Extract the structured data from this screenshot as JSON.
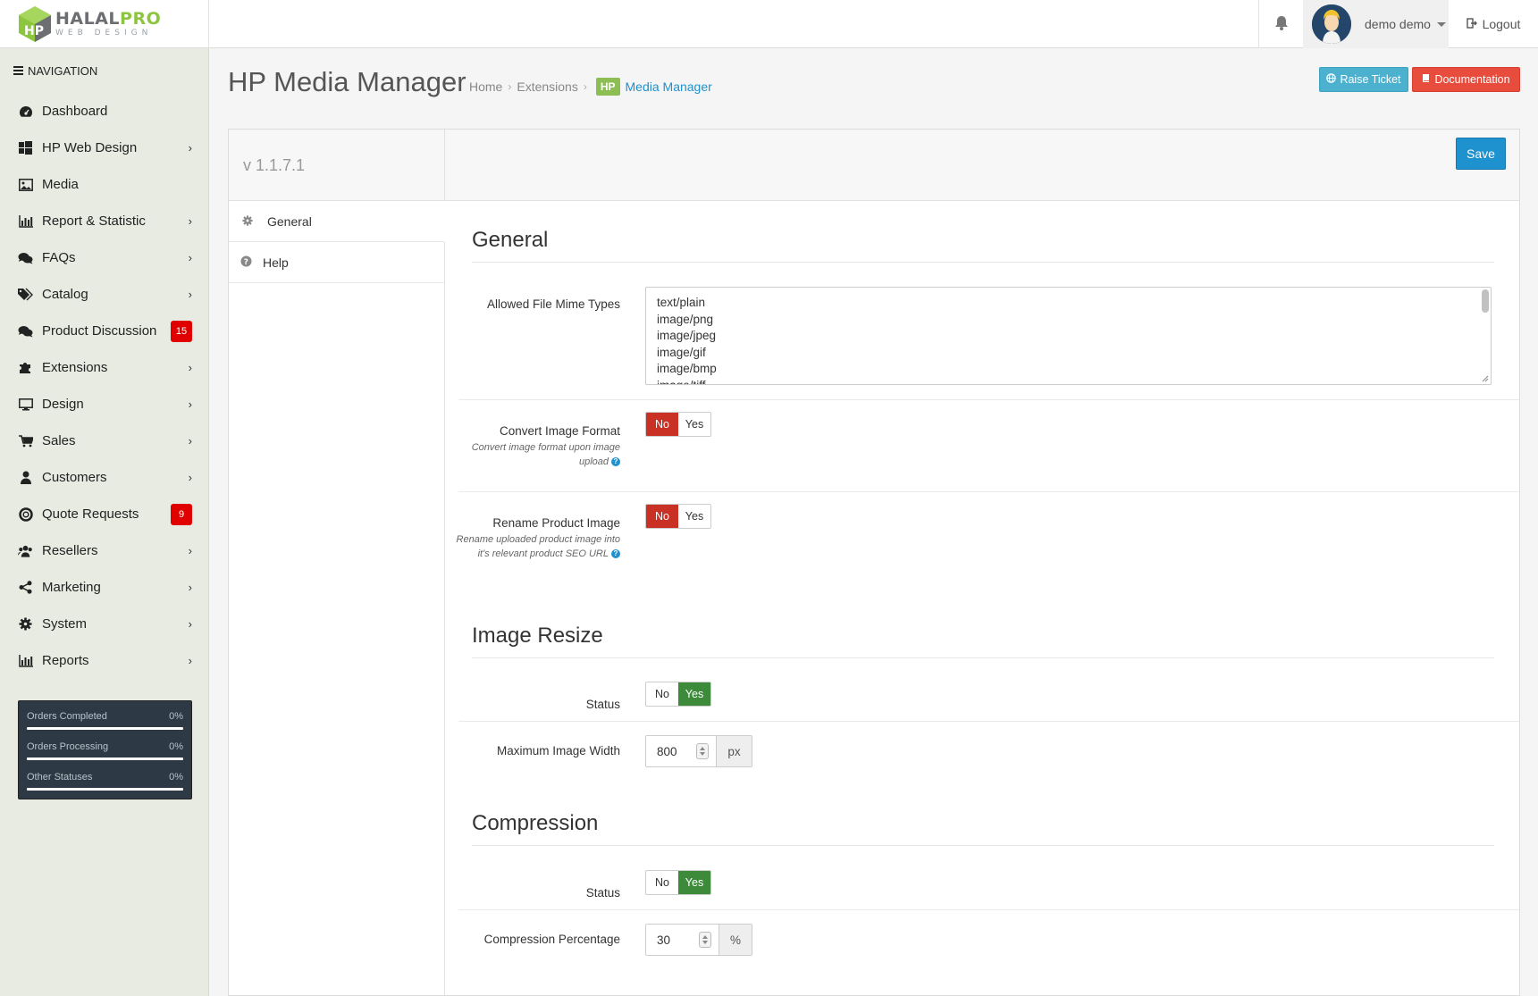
{
  "brand": {
    "name_part1": "HALAL",
    "name_part2": "PRO",
    "tagline": "WEB DESIGN"
  },
  "header": {
    "user_name": "demo demo",
    "logout_label": "Logout"
  },
  "sidebar": {
    "title": "NAVIGATION",
    "items": [
      {
        "label": "Dashboard",
        "icon": "dashboard-icon",
        "has_children": false
      },
      {
        "label": "HP Web Design",
        "icon": "windows-icon",
        "has_children": true
      },
      {
        "label": "Media",
        "icon": "image-icon",
        "has_children": false
      },
      {
        "label": "Report & Statistic",
        "icon": "bar-chart-icon",
        "has_children": true
      },
      {
        "label": "FAQs",
        "icon": "comments-icon",
        "has_children": true
      },
      {
        "label": "Catalog",
        "icon": "tags-icon",
        "has_children": true
      },
      {
        "label": "Product Discussion",
        "icon": "comments-icon",
        "badge": "15"
      },
      {
        "label": "Extensions",
        "icon": "puzzle-icon",
        "has_children": true
      },
      {
        "label": "Design",
        "icon": "monitor-icon",
        "has_children": true
      },
      {
        "label": "Sales",
        "icon": "cart-icon",
        "has_children": true
      },
      {
        "label": "Customers",
        "icon": "user-icon",
        "has_children": true
      },
      {
        "label": "Quote Requests",
        "icon": "life-ring-icon",
        "badge": "9"
      },
      {
        "label": "Resellers",
        "icon": "users-icon",
        "has_children": true
      },
      {
        "label": "Marketing",
        "icon": "share-icon",
        "has_children": true
      },
      {
        "label": "System",
        "icon": "gear-icon",
        "has_children": true
      },
      {
        "label": "Reports",
        "icon": "bar-chart-icon",
        "has_children": true
      }
    ],
    "stats": [
      {
        "label": "Orders Completed",
        "value": "0%"
      },
      {
        "label": "Orders Processing",
        "value": "0%"
      },
      {
        "label": "Other Statuses",
        "value": "0%"
      }
    ]
  },
  "page": {
    "title": "HP Media Manager",
    "breadcrumb": {
      "home": "Home",
      "extensions": "Extensions",
      "hp_badge": "HP",
      "current": "Media Manager"
    },
    "raise_ticket_label": "Raise Ticket",
    "documentation_label": "Documentation"
  },
  "panel": {
    "version": "v 1.1.7.1",
    "save_label": "Save",
    "tabs": [
      {
        "label": "General",
        "icon": "gear-icon"
      },
      {
        "label": "Help",
        "icon": "question-circle-icon"
      }
    ]
  },
  "general": {
    "title": "General",
    "mime_label": "Allowed File Mime Types",
    "mime_types": [
      "text/plain",
      "image/png",
      "image/jpeg",
      "image/gif",
      "image/bmp",
      "image/tiff"
    ],
    "convert_label": "Convert Image Format",
    "convert_help": "Convert image format upon image upload",
    "convert_value": "No",
    "rename_label": "Rename Product Image",
    "rename_help": "Rename uploaded product image into it's relevant product SEO URL",
    "rename_value": "No"
  },
  "resize": {
    "title": "Image Resize",
    "status_label": "Status",
    "status_value": "Yes",
    "max_width_label": "Maximum Image Width",
    "max_width_value": "800",
    "max_width_unit": "px"
  },
  "compression": {
    "title": "Compression",
    "status_label": "Status",
    "status_value": "Yes",
    "percentage_label": "Compression Percentage",
    "percentage_value": "30",
    "percentage_unit": "%"
  },
  "toggle_labels": {
    "no": "No",
    "yes": "Yes"
  },
  "colors": {
    "accent_blue": "#1e91cf",
    "toggle_no_active": "#c83124",
    "toggle_yes_active": "#3c8a3a",
    "badge_red": "#e10000",
    "brand_green": "#8cc63f",
    "sidebar_bg": "#e8ebe2"
  }
}
